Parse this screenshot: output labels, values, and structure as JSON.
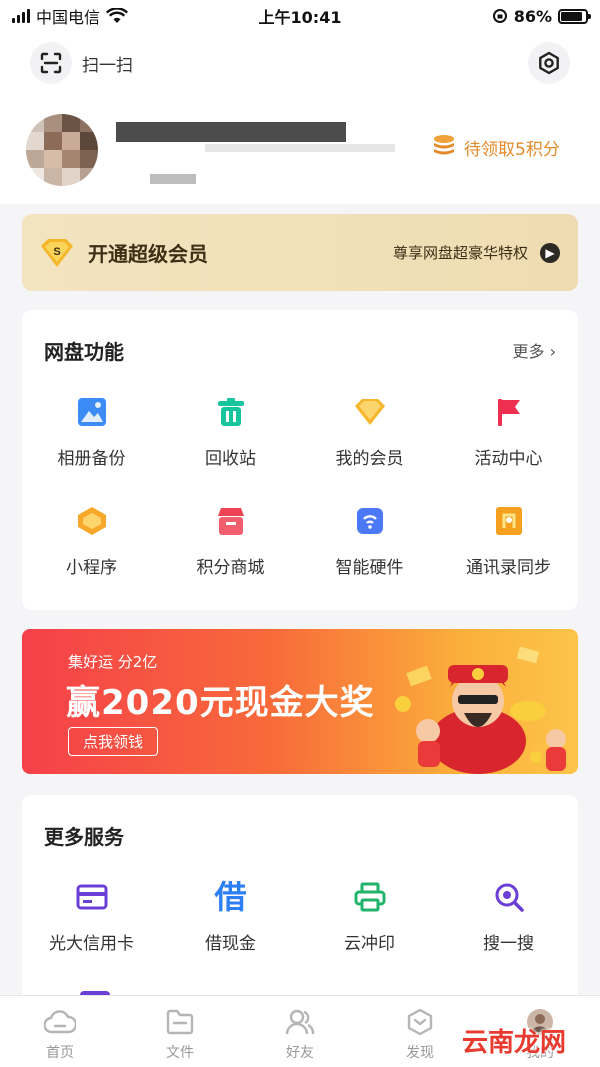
{
  "status_bar": {
    "carrier": "中国电信",
    "time": "上午10:41",
    "battery": "86%",
    "battery_level": 0.86
  },
  "top_bar": {
    "scan_label": "扫一扫"
  },
  "profile": {
    "points_text": "待领取5积分"
  },
  "vip": {
    "title": "开通超级会员",
    "subtitle": "尊享网盘超豪华特权",
    "badge_letter": "S"
  },
  "disk_functions": {
    "title": "网盘功能",
    "more": "更多 ›",
    "items": [
      {
        "label": "相册备份",
        "icon": "photo-icon",
        "color": "#3d8cf5"
      },
      {
        "label": "回收站",
        "icon": "trash-icon",
        "color": "#16c49e"
      },
      {
        "label": "我的会员",
        "icon": "diamond-icon",
        "color": "#f6b52b"
      },
      {
        "label": "活动中心",
        "icon": "flag-icon",
        "color": "#ef2f4f"
      },
      {
        "label": "小程序",
        "icon": "mini-program-icon",
        "color": "#f7a72a"
      },
      {
        "label": "积分商城",
        "icon": "store-icon",
        "color": "#ee4355"
      },
      {
        "label": "智能硬件",
        "icon": "hardware-icon",
        "color": "#4b79f5"
      },
      {
        "label": "通讯录同步",
        "icon": "contacts-icon",
        "color": "#f6a020"
      }
    ]
  },
  "banner": {
    "subtitle": "集好运 分2亿",
    "headline": "赢2020元现金大奖",
    "button": "点我领钱"
  },
  "more_services": {
    "title": "更多服务",
    "items": [
      {
        "label": "光大信用卡",
        "icon": "credit-card-icon",
        "color": "#6b3fd6"
      },
      {
        "label": "借现金",
        "icon": "borrow-icon",
        "glyph": "借",
        "color": "#2d7ff5"
      },
      {
        "label": "云冲印",
        "icon": "printer-icon",
        "color": "#21b36a"
      },
      {
        "label": "搜一搜",
        "icon": "search-icon",
        "color": "#6b3fd6"
      }
    ]
  },
  "tab_bar": {
    "tabs": [
      {
        "label": "首页",
        "icon": "home-cloud-icon"
      },
      {
        "label": "文件",
        "icon": "folder-icon"
      },
      {
        "label": "好友",
        "icon": "friends-icon"
      },
      {
        "label": "发现",
        "icon": "discover-icon"
      },
      {
        "label": "我的",
        "icon": "me-icon"
      }
    ]
  },
  "watermark": "云南龙网"
}
